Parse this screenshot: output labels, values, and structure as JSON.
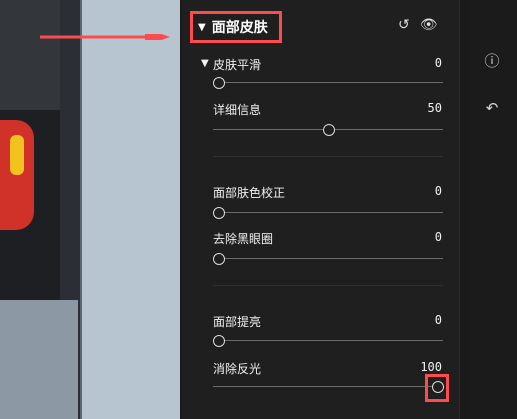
{
  "section": {
    "title": "面部皮肤",
    "collapse_icon": "triangle-down-icon",
    "reset_icon": "reset-icon",
    "visibility_icon": "eye-icon"
  },
  "skin_smoothing": {
    "label": "皮肤平滑",
    "value": "0",
    "slider_value": 0,
    "slider_max": 100
  },
  "detail_info": {
    "label": "详细信息",
    "value": "50",
    "slider_value": 50,
    "slider_max": 100
  },
  "face_tone": {
    "label": "面部肤色校正",
    "value": "0",
    "slider_value": 0,
    "slider_max": 100
  },
  "dark_circles": {
    "label": "去除黑眼圈",
    "value": "0",
    "slider_value": 0,
    "slider_max": 100
  },
  "face_brighten": {
    "label": "面部提亮",
    "value": "0",
    "slider_value": 0,
    "slider_max": 100
  },
  "remove_shine": {
    "label": "消除反光",
    "value": "100",
    "slider_value": 100,
    "slider_max": 100
  },
  "toolbar": {
    "info_icon": "info-icon",
    "undo_icon": "undo-icon"
  },
  "colors": {
    "highlight": "#ff4b4b",
    "panel_bg": "#1f1f1f",
    "text": "#f0f0f0"
  }
}
